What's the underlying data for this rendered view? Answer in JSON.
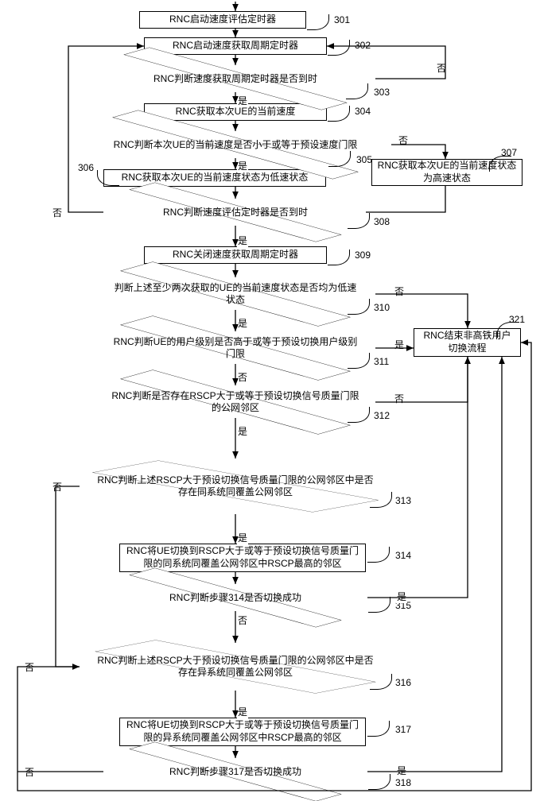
{
  "nodes": {
    "n301": "RNC启动速度评估定时器",
    "n302": "RNC启动速度获取周期定时器",
    "n303": "RNC判断速度获取周期定时器是否到时",
    "n304": "RNC获取本次UE的当前速度",
    "n305": "RNC判断本次UE的当前速度是否小于或等于预设速度门限",
    "n306": "RNC获取本次UE的当前速度状态为低速状态",
    "n307": "RNC获取本次UE的当前速度状态为高速状态",
    "n308": "RNC判断速度评估定时器是否到时",
    "n309": "RNC关闭速度获取周期定时器",
    "n310": "判断上述至少两次获取的UE的当前速度状态是否均为低速状态",
    "n311": "RNC判断UE的用户级别是否高于或等于预设切换用户级别门限",
    "n312": "RNC判断是否存在RSCP大于或等于预设切换信号质量门限的公网邻区",
    "n313": "RNC判断上述RSCP大于预设切换信号质量门限的公网邻区中是否存在同系统同覆盖公网邻区",
    "n314": "RNC将UE切换到RSCP大于或等于预设切换信号质量门限的同系统同覆盖公网邻区中RSCP最高的邻区",
    "n315": "RNC判断步骤314是否切换成功",
    "n316": "RNC判断上述RSCP大于预设切换信号质量门限的公网邻区中是否存在异系统同覆盖公网邻区",
    "n317": "RNC将UE切换到RSCP大于或等于预设切换信号质量门限的异系统同覆盖公网邻区中RSCP最高的邻区",
    "n318": "RNC判断步骤317是否切换成功",
    "n321": "RNC结束非高铁用户切换流程"
  },
  "refs": {
    "r301": "301",
    "r302": "302",
    "r303": "303",
    "r304": "304",
    "r305": "305",
    "r306": "306",
    "r307": "307",
    "r308": "308",
    "r309": "309",
    "r310": "310",
    "r311": "311",
    "r312": "312",
    "r313": "313",
    "r314": "314",
    "r315": "315",
    "r316": "316",
    "r317": "317",
    "r318": "318",
    "r321": "321"
  },
  "labels": {
    "yes": "是",
    "no": "否"
  }
}
